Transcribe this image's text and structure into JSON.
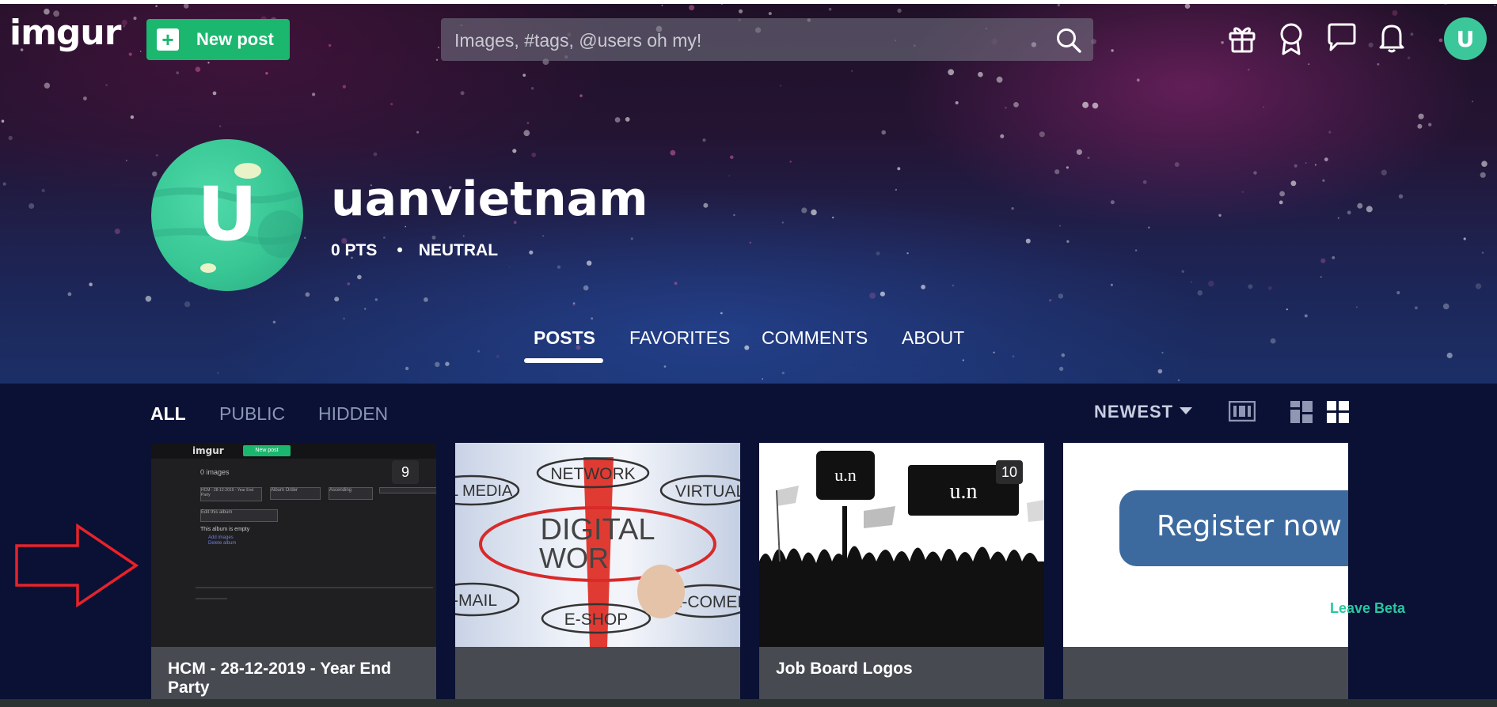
{
  "header": {
    "logo": "imgur",
    "new_post_label": "New post",
    "search_placeholder": "Images, #tags, @users oh my!",
    "icons": [
      "gift-icon",
      "medal-icon",
      "chat-icon",
      "bell-icon"
    ],
    "user_initial": "U"
  },
  "profile": {
    "avatar_initial": "U",
    "username": "uanvietnam",
    "points": "0 PTS",
    "separator": "•",
    "status": "NEUTRAL"
  },
  "profile_tabs": [
    {
      "label": "POSTS",
      "active": true
    },
    {
      "label": "FAVORITES",
      "active": false
    },
    {
      "label": "COMMENTS",
      "active": false
    },
    {
      "label": "ABOUT",
      "active": false
    }
  ],
  "filters": [
    {
      "label": "ALL",
      "active": true
    },
    {
      "label": "PUBLIC",
      "active": false
    },
    {
      "label": "HIDDEN",
      "active": false
    }
  ],
  "sort": {
    "label": "NEWEST"
  },
  "view_icons": [
    "filmstrip-view-icon",
    "masonry-view-icon",
    "grid-view-icon"
  ],
  "cards": [
    {
      "title": "HCM - 28-12-2019 - Year End Party",
      "count": "9",
      "thumb": {
        "logo": "imgur",
        "new_post": "New post",
        "images": "0 images",
        "select1": "HCM - 28-12-2019 - Year End Party",
        "select2": "Album Order",
        "select3": "Ascending",
        "select4": "Edit this album",
        "empty": "This album is empty",
        "add": "Add images",
        "delete": "Delete album"
      }
    },
    {
      "title": "",
      "thumb": {
        "center1": "DIGITAL",
        "center2": "WOR",
        "bubbles": [
          "NETWORK",
          "VIRTUAL",
          "AL MEDIA",
          "E-MAIL",
          "E-SHOP",
          "E-COMER"
        ]
      }
    },
    {
      "title": "Job Board Logos",
      "count": "10",
      "thumb": {
        "sign1": "u.n",
        "sign2": "u.n"
      }
    },
    {
      "title": "",
      "thumb": {
        "button": "Register now"
      }
    }
  ],
  "leave_beta": "Leave Beta",
  "colors": {
    "brand_green": "#1bb76e",
    "avatar_teal": "#3cc79a",
    "page_bg": "#0a1135",
    "card_bg": "#474a51",
    "leave_beta": "#27c7a0",
    "annotation_arrow": "#e8222a"
  }
}
